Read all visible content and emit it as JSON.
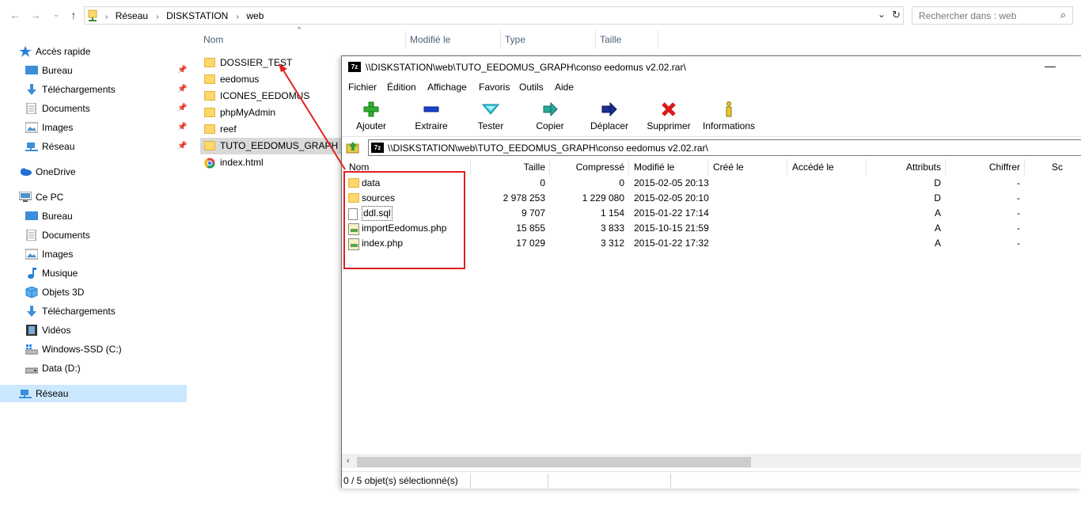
{
  "address": {
    "crumbs": [
      "Réseau",
      "DISKSTATION",
      "web"
    ],
    "search_placeholder": "Rechercher dans : web"
  },
  "sidebar": {
    "items": [
      {
        "label": "Accès rapide"
      },
      {
        "label": "Bureau"
      },
      {
        "label": "Téléchargements"
      },
      {
        "label": "Documents"
      },
      {
        "label": "Images"
      },
      {
        "label": "Réseau"
      },
      {
        "label": "OneDrive"
      },
      {
        "label": "Ce PC"
      },
      {
        "label": "Bureau"
      },
      {
        "label": "Documents"
      },
      {
        "label": "Images"
      },
      {
        "label": "Musique"
      },
      {
        "label": "Objets 3D"
      },
      {
        "label": "Téléchargements"
      },
      {
        "label": "Vidéos"
      },
      {
        "label": "Windows-SSD (C:)"
      },
      {
        "label": "Data (D:)"
      },
      {
        "label": "Réseau"
      }
    ]
  },
  "explorer": {
    "columns": [
      "Nom",
      "Modifié le",
      "Type",
      "Taille"
    ],
    "files": [
      {
        "name": "DOSSIER_TEST",
        "type": "folder"
      },
      {
        "name": "eedomus",
        "type": "folder"
      },
      {
        "name": "ICONES_EEDOMUS",
        "type": "folder"
      },
      {
        "name": "phpMyAdmin",
        "type": "folder"
      },
      {
        "name": "reef",
        "type": "folder"
      },
      {
        "name": "TUTO_EEDOMUS_GRAPH",
        "type": "folder"
      },
      {
        "name": "index.html",
        "type": "chrome-html"
      }
    ]
  },
  "sevenzip": {
    "logo": "7z",
    "title": "\\\\DISKSTATION\\web\\TUTO_EEDOMUS_GRAPH\\conso eedomus v2.02.rar\\",
    "minimize": "—",
    "menu": [
      "Fichier",
      "Édition",
      "Affichage",
      "Favoris",
      "Outils",
      "Aide"
    ],
    "toolbar": [
      "Ajouter",
      "Extraire",
      "Tester",
      "Copier",
      "Déplacer",
      "Supprimer",
      "Informations"
    ],
    "path": "\\\\DISKSTATION\\web\\TUTO_EEDOMUS_GRAPH\\conso eedomus v2.02.rar\\",
    "columns": [
      "Nom",
      "Taille",
      "Compressé",
      "Modifié le",
      "Créé le",
      "Accédé le",
      "Attributs",
      "Chiffrer",
      "Sc"
    ],
    "rows": [
      {
        "name": "data",
        "size": "0",
        "packed": "0",
        "modified": "2015-02-05 20:13",
        "attr": "D",
        "enc": "-",
        "icon": "folder"
      },
      {
        "name": "sources",
        "size": "2 978 253",
        "packed": "1 229 080",
        "modified": "2015-02-05 20:10",
        "attr": "D",
        "enc": "-",
        "icon": "folder"
      },
      {
        "name": "ddl.sql",
        "size": "9 707",
        "packed": "1 154",
        "modified": "2015-01-22 17:14",
        "attr": "A",
        "enc": "-",
        "icon": "doc"
      },
      {
        "name": "importEedomus.php",
        "size": "15 855",
        "packed": "3 833",
        "modified": "2015-10-15 21:59",
        "attr": "A",
        "enc": "-",
        "icon": "php"
      },
      {
        "name": "index.php",
        "size": "17 029",
        "packed": "3 312",
        "modified": "2015-01-22 17:32",
        "attr": "A",
        "enc": "-",
        "icon": "php"
      }
    ],
    "status": "0 / 5 objet(s) sélectionné(s)"
  },
  "colors": {
    "annotation": "#e02020",
    "selection": "#cce8ff",
    "folder": "#ffd76b"
  }
}
